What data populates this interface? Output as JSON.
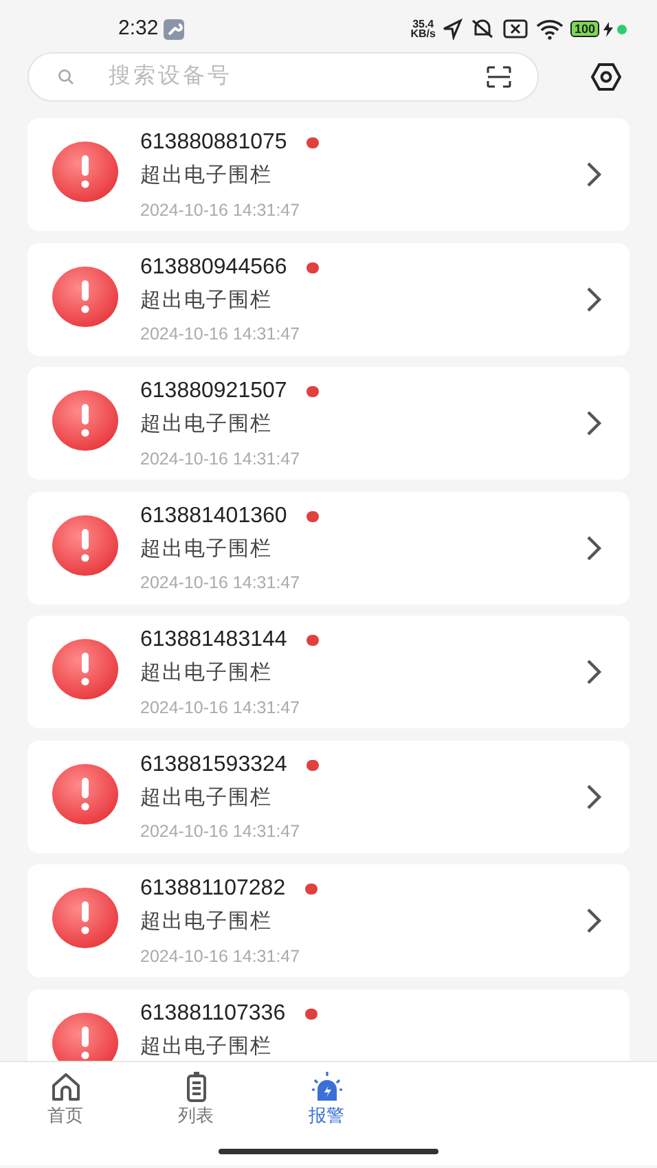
{
  "status_bar": {
    "time": "2:32",
    "net_speed": "35.4",
    "net_unit": "KB/s",
    "battery": "100"
  },
  "search": {
    "placeholder": "搜索设备号"
  },
  "alarms": [
    {
      "device": "613880881075",
      "unread": true,
      "message": "超出电子围栏",
      "time": "2024-10-16 14:31:47"
    },
    {
      "device": "613880944566",
      "unread": true,
      "message": "超出电子围栏",
      "time": "2024-10-16 14:31:47"
    },
    {
      "device": "613880921507",
      "unread": true,
      "message": "超出电子围栏",
      "time": "2024-10-16 14:31:47"
    },
    {
      "device": "613881401360",
      "unread": true,
      "message": "超出电子围栏",
      "time": "2024-10-16 14:31:47"
    },
    {
      "device": "613881483144",
      "unread": true,
      "message": "超出电子围栏",
      "time": "2024-10-16 14:31:47"
    },
    {
      "device": "613881593324",
      "unread": true,
      "message": "超出电子围栏",
      "time": "2024-10-16 14:31:47"
    },
    {
      "device": "613881107282",
      "unread": true,
      "message": "超出电子围栏",
      "time": "2024-10-16 14:31:47"
    },
    {
      "device": "613881107336",
      "unread": true,
      "message": "超出电子围栏"
    }
  ],
  "tabs": [
    {
      "label": "首页",
      "kind": "home",
      "selected": false
    },
    {
      "label": "列表",
      "kind": "list",
      "selected": false
    },
    {
      "label": "报警",
      "kind": "alarm",
      "selected": true
    }
  ]
}
